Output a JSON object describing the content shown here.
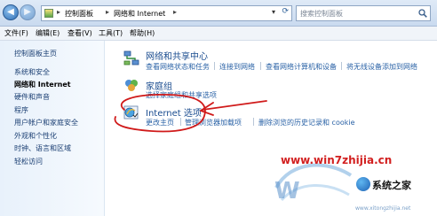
{
  "address_bar": {
    "crumbs": [
      "控制面板",
      "网络和 Internet"
    ],
    "search_placeholder": "搜索控制面板"
  },
  "menu": [
    "文件(F)",
    "编辑(E)",
    "查看(V)",
    "工具(T)",
    "帮助(H)"
  ],
  "left_nav": {
    "items": [
      {
        "label": "控制面板主页"
      },
      {
        "label": "系统和安全"
      },
      {
        "label": "网络和 Internet"
      },
      {
        "label": "硬件和声音"
      },
      {
        "label": "程序"
      },
      {
        "label": "用户帐户和家庭安全"
      },
      {
        "label": "外观和个性化"
      },
      {
        "label": "时钟、语言和区域"
      },
      {
        "label": "轻松访问"
      }
    ]
  },
  "categories": [
    {
      "title": "网络和共享中心",
      "icon": "network-icon",
      "links": [
        "查看网络状态和任务",
        "连接到网络",
        "查看网络计算机和设备",
        "将无线设备添加到网络"
      ]
    },
    {
      "title": "家庭组",
      "icon": "homegroup-icon",
      "links": [
        "选择家庭组和共享选项"
      ]
    },
    {
      "title": "Internet 选项",
      "icon": "internet-options-icon",
      "links": [
        "更改主页",
        "管理浏览器加载项",
        "删除浏览的历史记录和 cookie"
      ]
    }
  ],
  "watermark": {
    "url": "www.win7zhijia.cn",
    "name": "系统之家",
    "sub": "www.xitongzhijia.net"
  },
  "colors": {
    "annotation": "#d01a1a",
    "link": "#2a62a6",
    "title": "#1a4c8f"
  }
}
